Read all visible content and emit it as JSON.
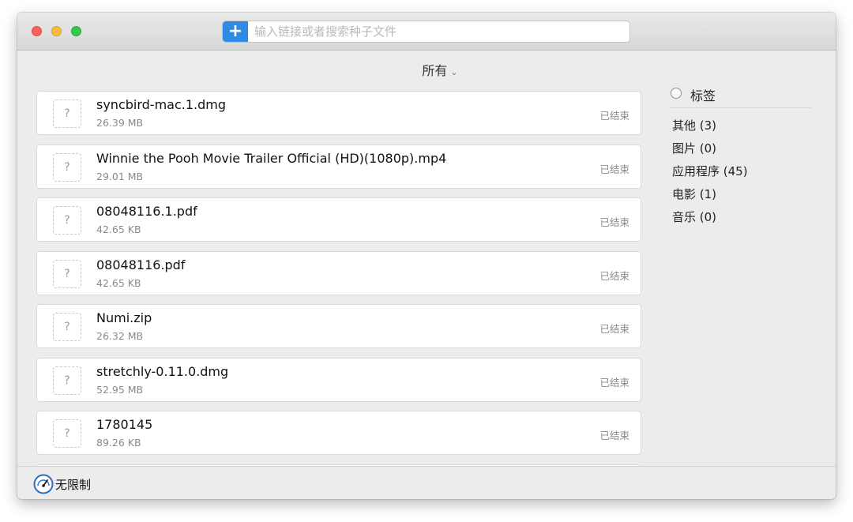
{
  "search": {
    "add_label": "+",
    "placeholder": "输入链接或者搜索种子文件"
  },
  "filter": {
    "label": "所有",
    "chevron": "⌄"
  },
  "downloads": [
    {
      "icon": "?",
      "name": "syncbird-mac.1.dmg",
      "size": "26.39 MB",
      "status": "已结束"
    },
    {
      "icon": "?",
      "name": "Winnie the Pooh Movie Trailer Official (HD)(1080p).mp4",
      "size": "29.01 MB",
      "status": "已结束"
    },
    {
      "icon": "?",
      "name": "08048116.1.pdf",
      "size": "42.65 KB",
      "status": "已结束"
    },
    {
      "icon": "?",
      "name": "08048116.pdf",
      "size": "42.65 KB",
      "status": "已结束"
    },
    {
      "icon": "?",
      "name": "Numi.zip",
      "size": "26.32 MB",
      "status": "已结束"
    },
    {
      "icon": "?",
      "name": "stretchly-0.11.0.dmg",
      "size": "52.95 MB",
      "status": "已结束"
    },
    {
      "icon": "?",
      "name": "1780145",
      "size": "89.26 KB",
      "status": "已结束"
    }
  ],
  "sidebar": {
    "tag_title": "标签",
    "categories": [
      {
        "label": "其他 (3)"
      },
      {
        "label": "图片 (0)"
      },
      {
        "label": "应用程序 (45)"
      },
      {
        "label": "电影 (1)"
      },
      {
        "label": "音乐 (0)"
      }
    ]
  },
  "footer": {
    "speed_label": "无限制",
    "speed_icon": "speedometer-icon"
  },
  "colors": {
    "accent": "#2f8ae5",
    "close": "#fc605c",
    "minimize": "#fdbc40",
    "maximize": "#34c84a"
  }
}
